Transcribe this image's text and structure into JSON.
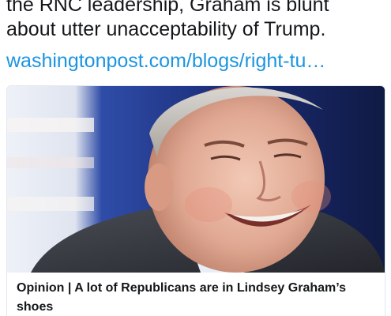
{
  "tweet": {
    "text_line_1": "the RNC leadership, Graham is blunt",
    "text_line_2": "about utter unacceptability of Trump.",
    "link_text": "washingtonpost.com/blogs/right-tu…"
  },
  "card": {
    "title": "Opinion | A lot of Republicans are in Lindsey Graham’s shoes",
    "image_subject": "photo of smiling man in suit"
  },
  "colors": {
    "link": "#1b95e0",
    "text": "#14171a",
    "border": "#e1e8ed"
  }
}
